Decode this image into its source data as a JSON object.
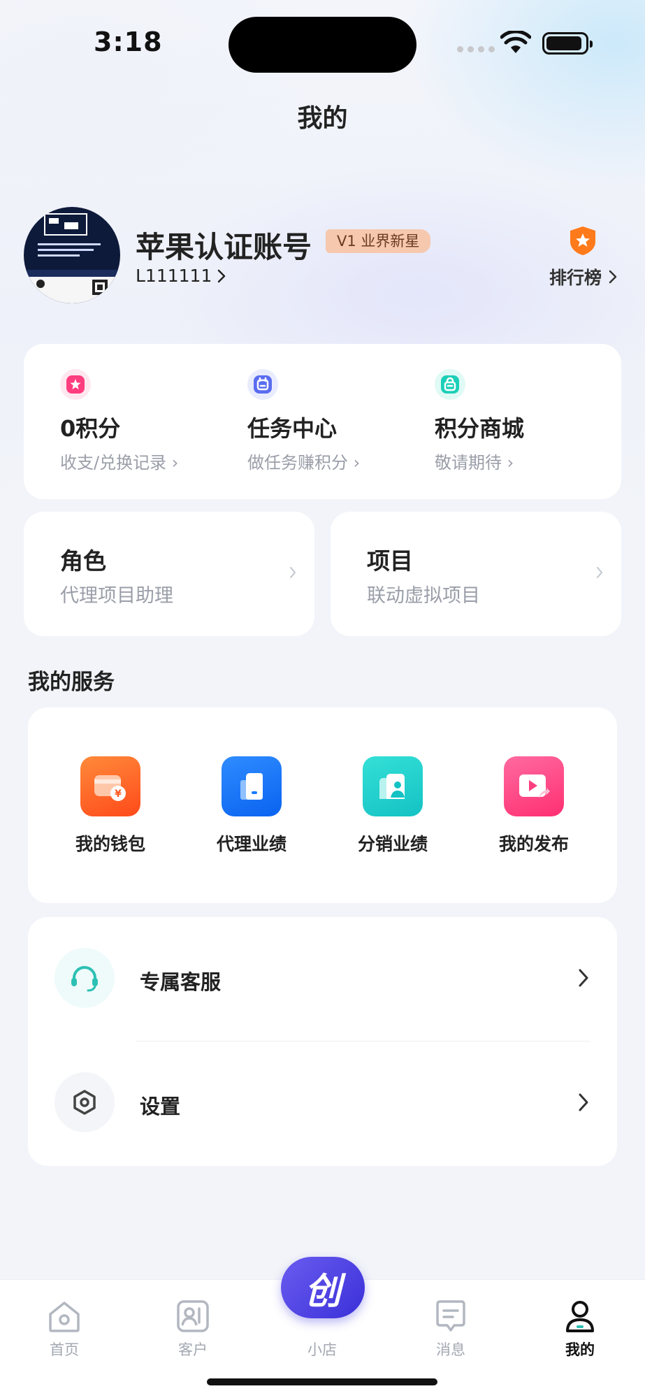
{
  "status_bar": {
    "time": "3:18"
  },
  "page": {
    "title": "我的"
  },
  "profile": {
    "name": "苹果认证账号",
    "level_badge": "V1 业界新星",
    "user_id": "L111111",
    "rank_label": "排行榜"
  },
  "points": [
    {
      "title": "0积分",
      "subtitle": "收支/兑换记录",
      "icon": "flower-icon",
      "color": "#ff3d7f"
    },
    {
      "title": "任务中心",
      "subtitle": "做任务赚积分",
      "icon": "task-icon",
      "color": "#5a6cf0"
    },
    {
      "title": "积分商城",
      "subtitle": "敬请期待",
      "icon": "shop-bag-icon",
      "color": "#1ccfb8"
    }
  ],
  "role": {
    "title": "角色",
    "value": "代理项目助理"
  },
  "project": {
    "title": "项目",
    "value": "联动虚拟项目"
  },
  "services": {
    "title": "我的服务",
    "items": [
      {
        "label": "我的钱包",
        "icon": "wallet-icon",
        "color": "#ff6a2a"
      },
      {
        "label": "代理业绩",
        "icon": "agent-performance-icon",
        "color": "#1a7cff"
      },
      {
        "label": "分销业绩",
        "icon": "distribution-icon",
        "color": "#1fd3cc"
      },
      {
        "label": "我的发布",
        "icon": "publish-icon",
        "color": "#ff4d8a"
      }
    ]
  },
  "menu": [
    {
      "label": "专属客服",
      "icon": "headset-icon"
    },
    {
      "label": "设置",
      "icon": "settings-hex-icon"
    }
  ],
  "tabbar": {
    "items": [
      {
        "label": "首页",
        "icon": "home-icon"
      },
      {
        "label": "客户",
        "icon": "contacts-icon"
      },
      {
        "label": "小店",
        "icon": "shop-icon"
      },
      {
        "label": "消息",
        "icon": "message-icon"
      },
      {
        "label": "我的",
        "icon": "profile-icon",
        "active": true
      }
    ],
    "center_glyph": "创"
  },
  "colors": {
    "accent": "#4b3fe0",
    "badge_bg": "#f6c8ae",
    "rank_orange": "#ff7a1a"
  }
}
